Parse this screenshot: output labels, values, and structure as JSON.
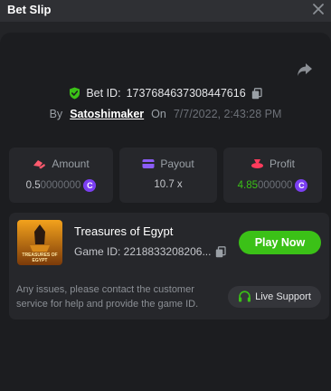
{
  "header": {
    "title": "Bet Slip"
  },
  "bet": {
    "id_label": "Bet ID:",
    "id_value": "1737684637308447616",
    "by_label": "By",
    "username": "Satoshimaker",
    "on_label": "On",
    "timestamp": "7/7/2022, 2:43:28 PM"
  },
  "stats": {
    "amount": {
      "label": "Amount",
      "value_main": "0.5",
      "value_dim": "0000000"
    },
    "payout": {
      "label": "Payout",
      "value": "10.7 x"
    },
    "profit": {
      "label": "Profit",
      "value_main": "4.85",
      "value_dim": "000000"
    }
  },
  "game": {
    "name": "Treasures of Egypt",
    "id_text": "Game ID: 2218833208206...",
    "thumb_text_1": "TREASURES OF",
    "thumb_text_2": "EGYPT",
    "play_label": "Play Now"
  },
  "support": {
    "text": "Any issues, please contact the customer service for help and provide the game ID.",
    "button_label": "Live Support"
  },
  "colors": {
    "accent_green": "#3bc117",
    "coin_purple": "#7b3ff2",
    "amount_icon": "#ff5a6e",
    "payout_icon": "#8b5cf6",
    "profit_icon": "#ff3b5c",
    "profit_value": "#3bc117"
  },
  "icons": {
    "close": "close-icon",
    "share": "share-icon",
    "verified": "shield-check-icon",
    "copy": "copy-icon",
    "amount": "amount-icon",
    "payout": "wallet-icon",
    "profit": "profit-icon",
    "coin": "coin-icon",
    "support": "headset-icon"
  }
}
